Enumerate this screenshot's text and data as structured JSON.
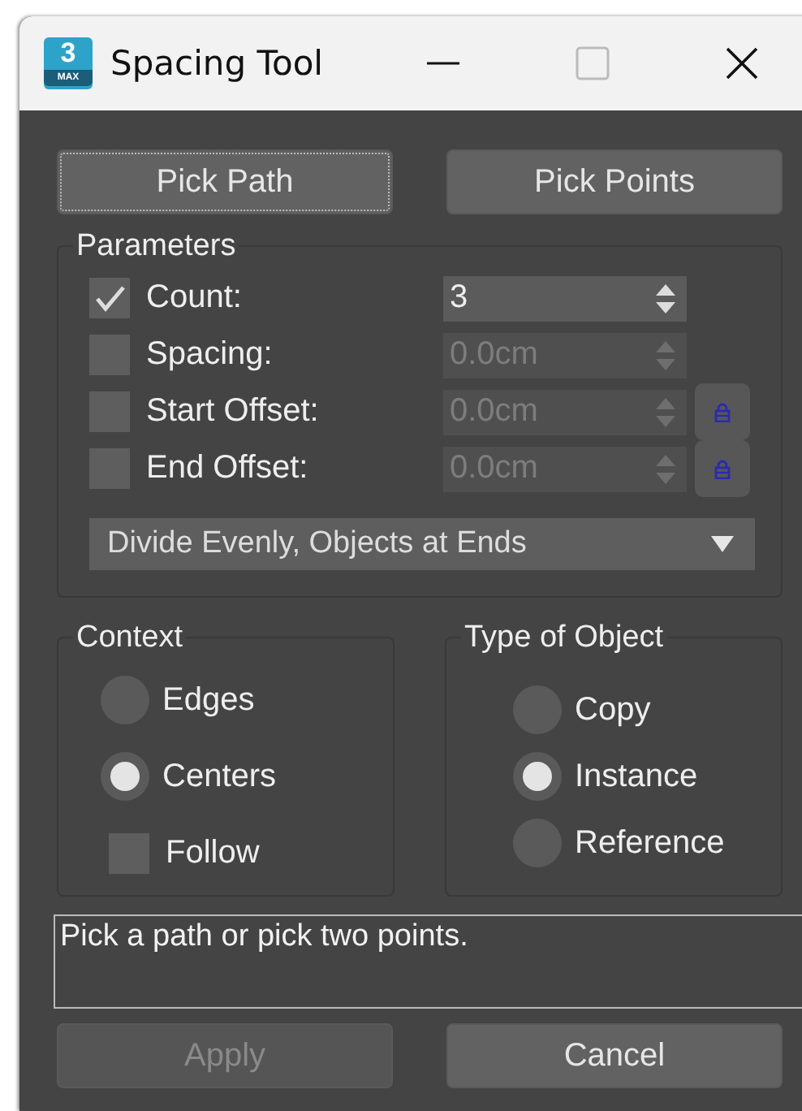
{
  "window": {
    "title": "Spacing Tool",
    "logo_number": "3",
    "logo_label": "MAX"
  },
  "top_buttons": [
    {
      "label": "Pick Path",
      "focused": true
    },
    {
      "label": "Pick Points",
      "focused": false
    }
  ],
  "parameters": {
    "title": "Parameters",
    "rows": [
      {
        "label": "Count:",
        "checked": true,
        "value": "3",
        "disabled": false,
        "lock": false
      },
      {
        "label": "Spacing:",
        "checked": false,
        "value": "0.0cm",
        "disabled": true,
        "lock": false
      },
      {
        "label": "Start Offset:",
        "checked": false,
        "value": "0.0cm",
        "disabled": true,
        "lock": true
      },
      {
        "label": "End Offset:",
        "checked": false,
        "value": "0.0cm",
        "disabled": true,
        "lock": true
      }
    ],
    "dropdown": "Divide Evenly, Objects at Ends"
  },
  "context": {
    "title": "Context",
    "options": [
      {
        "label": "Edges",
        "selected": false
      },
      {
        "label": "Centers",
        "selected": true
      }
    ],
    "follow": {
      "label": "Follow",
      "checked": false
    }
  },
  "type_of_object": {
    "title": "Type of Object",
    "options": [
      {
        "label": "Copy",
        "selected": false
      },
      {
        "label": "Instance",
        "selected": true
      },
      {
        "label": "Reference",
        "selected": false
      }
    ]
  },
  "status": "Pick a path or pick two points.",
  "bottom_buttons": [
    {
      "label": "Apply",
      "disabled": true
    },
    {
      "label": "Cancel",
      "disabled": false
    }
  ]
}
